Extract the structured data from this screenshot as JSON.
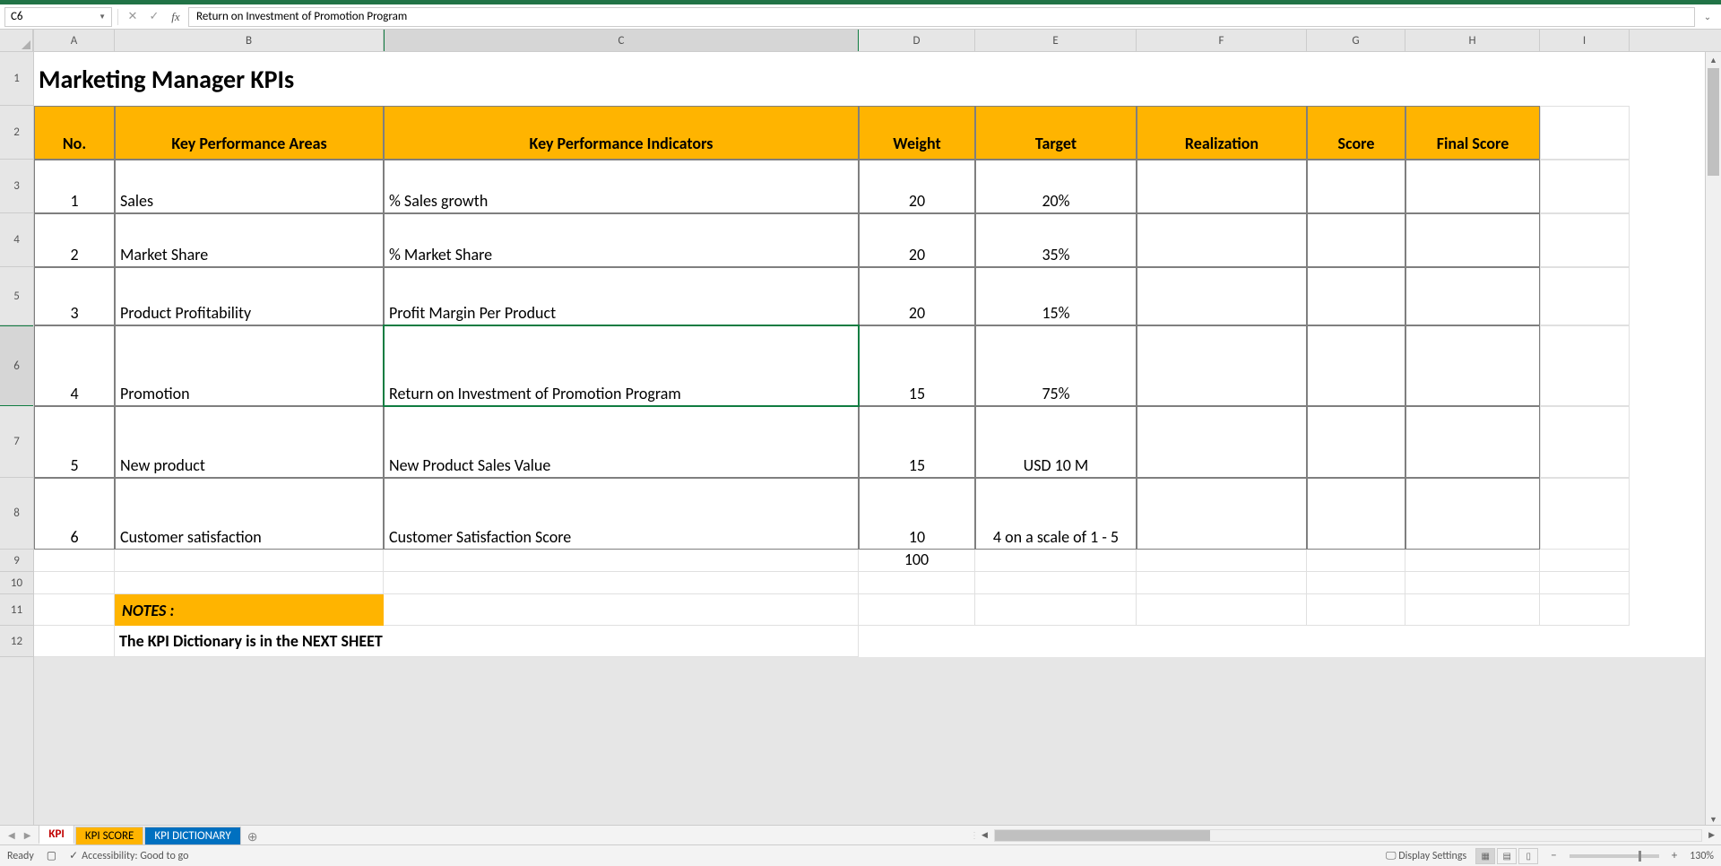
{
  "nameBox": "C6",
  "formulaBar": "Return on Investment of Promotion Program",
  "columns": [
    "A",
    "B",
    "C",
    "D",
    "E",
    "F",
    "G",
    "H",
    "I"
  ],
  "selectedCol": "C",
  "selectedRow": "6",
  "title": "Marketing Manager KPIs",
  "headers": {
    "no": "No.",
    "kpa": "Key Performance Areas",
    "kpi": "Key Performance Indicators",
    "weight": "Weight",
    "target": "Target",
    "realization": "Realization",
    "score": "Score",
    "final": "Final Score"
  },
  "rows": [
    {
      "no": "1",
      "kpa": "Sales",
      "kpi": "% Sales growth",
      "weight": "20",
      "target": "20%"
    },
    {
      "no": "2",
      "kpa": "Market Share",
      "kpi": "% Market Share",
      "weight": "20",
      "target": "35%"
    },
    {
      "no": "3",
      "kpa": "Product Profitability",
      "kpi": "Profit Margin Per Product",
      "weight": "20",
      "target": "15%"
    },
    {
      "no": "4",
      "kpa": "Promotion",
      "kpi": "Return on Investment of Promotion Program",
      "weight": "15",
      "target": "75%"
    },
    {
      "no": "5",
      "kpa": "New product",
      "kpi": "New Product Sales Value",
      "weight": "15",
      "target": "USD 10 M"
    },
    {
      "no": "6",
      "kpa": "Customer satisfaction",
      "kpi": "Customer Satisfaction Score",
      "weight": "10",
      "target": "4 on a scale of 1 - 5"
    }
  ],
  "totalWeight": "100",
  "notesLabel": "NOTES :",
  "notesText": "The KPI Dictionary is in the NEXT SHEET",
  "sheetTabs": {
    "kpi": "KPI",
    "score": "KPI SCORE",
    "dict": "KPI DICTIONARY"
  },
  "status": {
    "ready": "Ready",
    "accessibility": "Accessibility: Good to go",
    "displaySettings": "Display Settings",
    "zoom": "130%"
  }
}
